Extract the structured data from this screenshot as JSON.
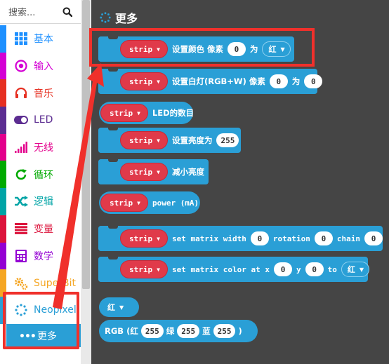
{
  "search": {
    "placeholder": "搜索..."
  },
  "categories": [
    {
      "label": "基本",
      "icon": "grid-icon",
      "color": "#1e90ff"
    },
    {
      "label": "输入",
      "icon": "target-icon",
      "color": "#d400d4"
    },
    {
      "label": "音乐",
      "icon": "headphones-icon",
      "color": "#e63022"
    },
    {
      "label": "LED",
      "icon": "toggle-icon",
      "color": "#5c2d91"
    },
    {
      "label": "无线",
      "icon": "signal-bars-icon",
      "color": "#e3008c"
    },
    {
      "label": "循环",
      "icon": "refresh-icon",
      "color": "#00aa00"
    },
    {
      "label": "逻辑",
      "icon": "shuffle-icon",
      "color": "#00a4a6"
    },
    {
      "label": "变量",
      "icon": "list-icon",
      "color": "#dc143c"
    },
    {
      "label": "数学",
      "icon": "calculator-icon",
      "color": "#9400d3"
    },
    {
      "label": "SuperBit",
      "icon": "gears-icon",
      "color": "#f5a623"
    },
    {
      "label": "Neopixel",
      "icon": "spinner-icon",
      "color": "#2a9fd6"
    }
  ],
  "more_category": {
    "label": "更多",
    "icon": "ellipsis-icon"
  },
  "flyout": {
    "title": "更多",
    "blocks": {
      "set_color": {
        "strip": "strip",
        "text1": "设置颜色 像素",
        "index": "0",
        "text2": "为",
        "color": "红"
      },
      "set_white": {
        "strip": "strip",
        "text1": "设置白灯(RGB+W) 像素",
        "index": "0",
        "text2": "为",
        "value": "0"
      },
      "led_count": {
        "strip": "strip",
        "text": "LED的数目"
      },
      "set_brightness": {
        "strip": "strip",
        "text": "设置亮度为",
        "value": "255"
      },
      "ease_brightness": {
        "strip": "strip",
        "text": "减小亮度"
      },
      "power": {
        "strip": "strip",
        "text": "power (mA)"
      },
      "matrix_width": {
        "strip": "strip",
        "text1": "set matrix width",
        "width": "0",
        "text2": "rotation",
        "rotation": "0",
        "text3": "chain",
        "chain": "0"
      },
      "matrix_color": {
        "strip": "strip",
        "text1": "set matrix color at x",
        "x": "0",
        "text2": "y",
        "y": "0",
        "text3": "to",
        "color": "红"
      },
      "color_enum": {
        "color": "红"
      },
      "rgb": {
        "text1": "RGB (红",
        "r": "255",
        "text2": "绿",
        "g": "255",
        "text3": "蓝",
        "b": "255",
        "text4": ")"
      }
    }
  },
  "annotation_color": "#f0302b",
  "accent_color": "#2a9fd6",
  "strip_color": "#e03a4a"
}
